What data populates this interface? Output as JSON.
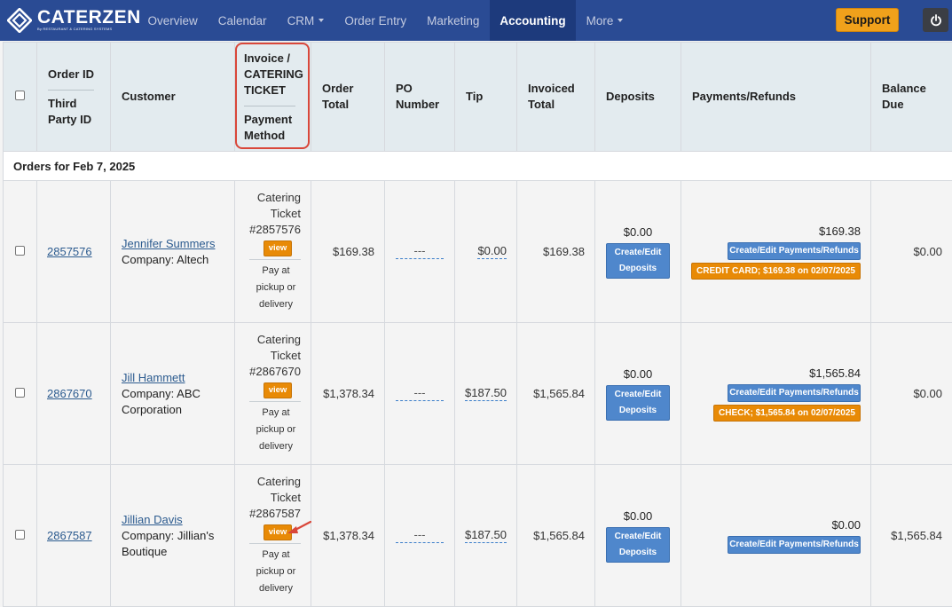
{
  "brand": {
    "name": "CATERZEN",
    "tagline": "By RESTAURANT & CATERING SYSTEMS"
  },
  "nav": {
    "items": [
      "Overview",
      "Calendar",
      "CRM",
      "Order Entry",
      "Marketing",
      "Accounting",
      "More"
    ],
    "active": "Accounting",
    "support_label": "Support"
  },
  "columns": {
    "order_id": "Order ID",
    "third_party_id": "Third Party ID",
    "customer": "Customer",
    "invoice": "Invoice / CATERING TICKET",
    "payment_method": "Payment Method",
    "order_total": "Order Total",
    "po_number": "PO Number",
    "tip": "Tip",
    "invoiced_total": "Invoiced Total",
    "deposits": "Deposits",
    "payments_refunds": "Payments/Refunds",
    "balance_due": "Balance Due"
  },
  "group_label": "Orders for Feb 7, 2025",
  "labels": {
    "view": "view",
    "create_edit_deposits": "Create/Edit Deposits",
    "create_edit_payments": "Create/Edit Payments/Refunds",
    "catering_ticket": "Catering Ticket",
    "pay_method": "Pay at pickup or delivery"
  },
  "orders": [
    {
      "order_id": "2857576",
      "customer_name": "Jennifer Summers",
      "company": "Company: Altech",
      "ticket_number": "#2857576",
      "order_total": "$169.38",
      "po": "---",
      "tip": "$0.00",
      "invoiced_total": "$169.38",
      "deposit": "$0.00",
      "payment_total": "$169.38",
      "payment_tag": "CREDIT CARD; $169.38 on 02/07/2025",
      "balance_due": "$0.00"
    },
    {
      "order_id": "2867670",
      "customer_name": "Jill Hammett",
      "company": "Company: ABC Corporation",
      "ticket_number": "#2867670",
      "order_total": "$1,378.34",
      "po": "---",
      "tip": "$187.50",
      "invoiced_total": "$1,565.84",
      "deposit": "$0.00",
      "payment_total": "$1,565.84",
      "payment_tag": "CHECK; $1,565.84 on 02/07/2025",
      "balance_due": "$0.00"
    },
    {
      "order_id": "2867587",
      "customer_name": "Jillian Davis",
      "company": "Company: Jillian's Boutique",
      "ticket_number": "#2867587",
      "order_total": "$1,378.34",
      "po": "---",
      "tip": "$187.50",
      "invoiced_total": "$1,565.84",
      "deposit": "$0.00",
      "payment_total": "$0.00",
      "payment_tag": "",
      "balance_due": "$1,565.84"
    }
  ],
  "colors": {
    "nav_bg": "#2a4b94",
    "accent_orange": "#e88a06",
    "button_blue": "#4f87cc",
    "highlight_red": "#d9473a"
  }
}
